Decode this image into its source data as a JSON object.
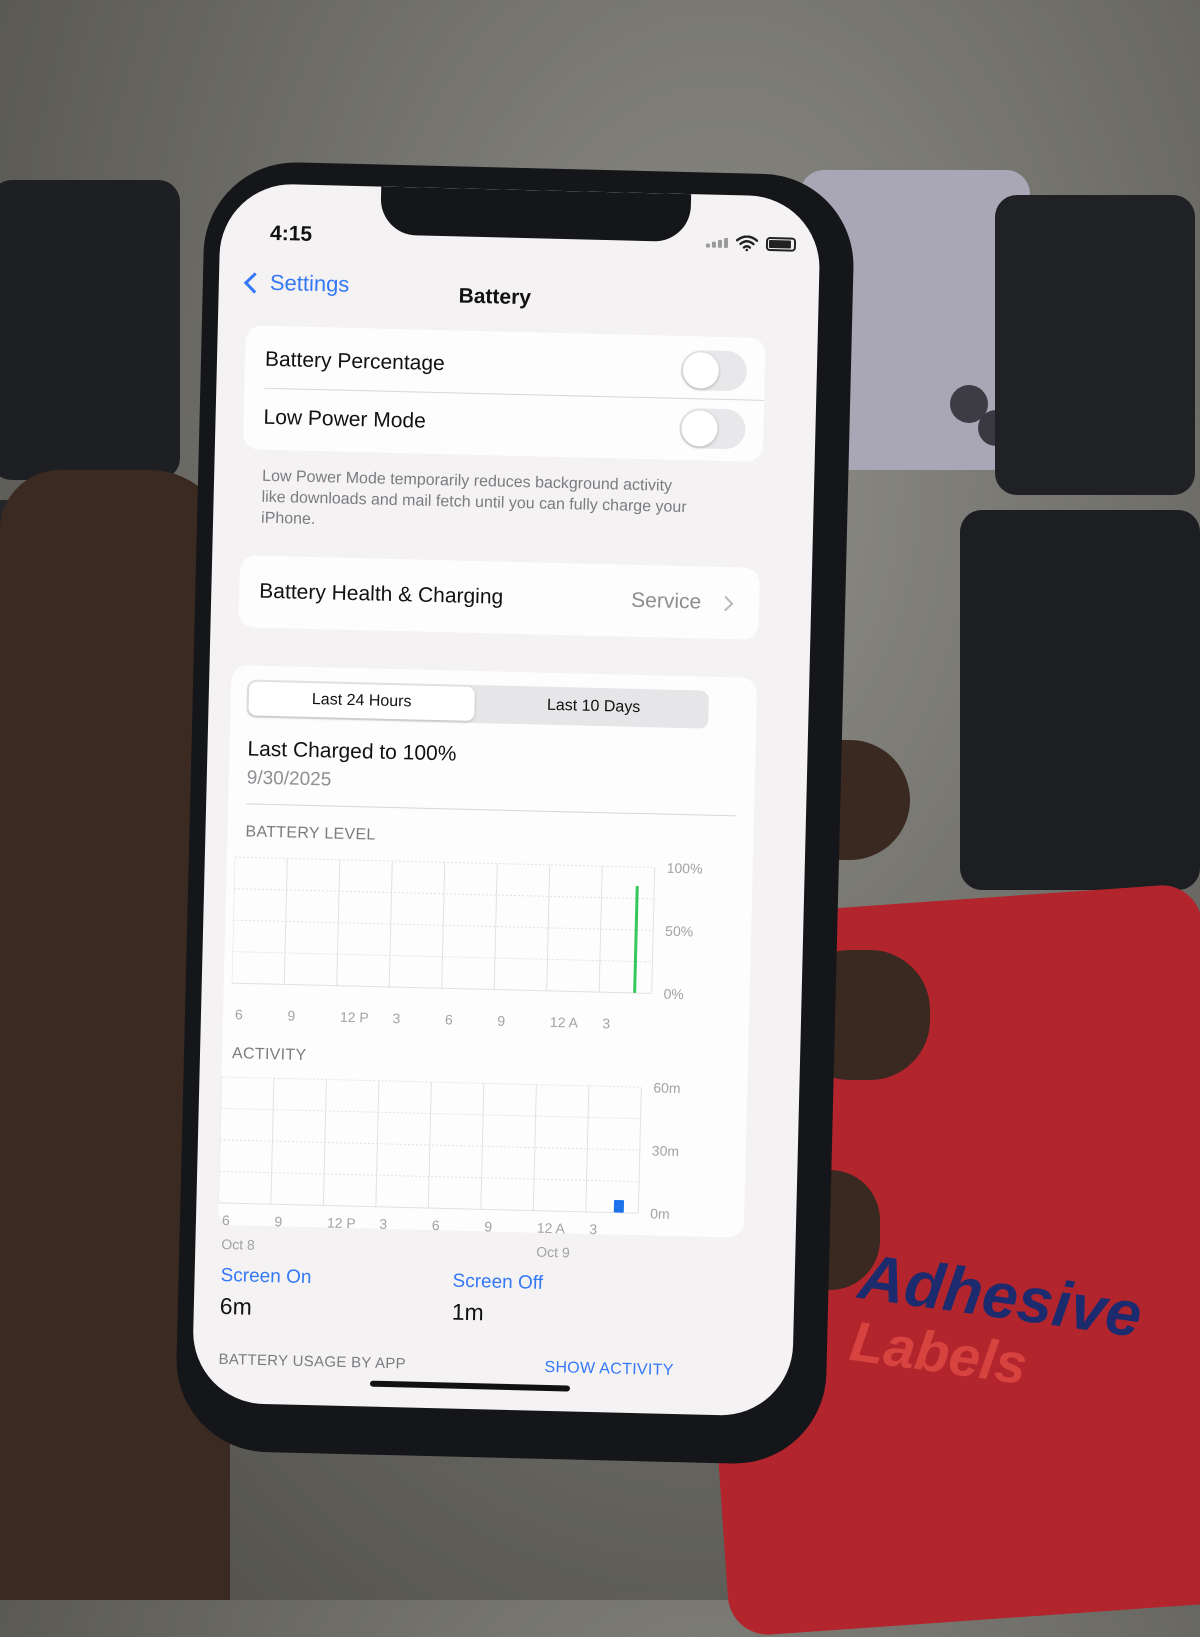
{
  "status_bar": {
    "time": "4:15"
  },
  "nav": {
    "back_label": "Settings",
    "title": "Battery"
  },
  "settings": {
    "battery_percentage": {
      "label": "Battery Percentage",
      "on": false
    },
    "low_power_mode": {
      "label": "Low Power Mode",
      "on": false
    },
    "low_power_footnote": "Low Power Mode temporarily reduces background activity like downloads and mail fetch until you can fully charge your iPhone."
  },
  "health": {
    "label": "Battery Health & Charging",
    "value": "Service"
  },
  "tabs": {
    "last_24": "Last 24 Hours",
    "last_10": "Last 10 Days",
    "selected": "last_24"
  },
  "last_charged": {
    "title": "Last Charged to 100%",
    "date": "9/30/2025"
  },
  "colors": {
    "accent": "#3478f6",
    "battery_green": "#34c759",
    "activity_blue": "#1a73e8"
  },
  "chart_data": [
    {
      "type": "bar",
      "title": "BATTERY LEVEL",
      "categories": [
        "6",
        "9",
        "12 P",
        "3",
        "6",
        "9",
        "12 A",
        "3"
      ],
      "y_tick_labels": [
        "100%",
        "50%",
        "0%"
      ],
      "ylim": [
        0,
        100
      ],
      "series": [
        {
          "values": [
            0,
            0,
            0,
            0,
            0,
            0,
            0,
            85
          ]
        }
      ],
      "color": "#34c759",
      "grid": true
    },
    {
      "type": "bar",
      "title": "ACTIVITY",
      "categories": [
        "6",
        "9",
        "12 P",
        "3",
        "6",
        "9",
        "12 A",
        "3"
      ],
      "date_labels": [
        "Oct 8",
        "Oct 9"
      ],
      "y_tick_labels": [
        "60m",
        "30m",
        "0m"
      ],
      "ylim": [
        0,
        60
      ],
      "series": [
        {
          "values": [
            0,
            0,
            0,
            0,
            0,
            0,
            0,
            6
          ]
        }
      ],
      "color": "#1a73e8",
      "grid": true
    }
  ],
  "screen_stats": {
    "on_label": "Screen On",
    "on_value": "6m",
    "off_label": "Screen Off",
    "off_value": "1m"
  },
  "usage": {
    "label": "BATTERY USAGE BY APP",
    "show_activity": "SHOW ACTIVITY"
  }
}
